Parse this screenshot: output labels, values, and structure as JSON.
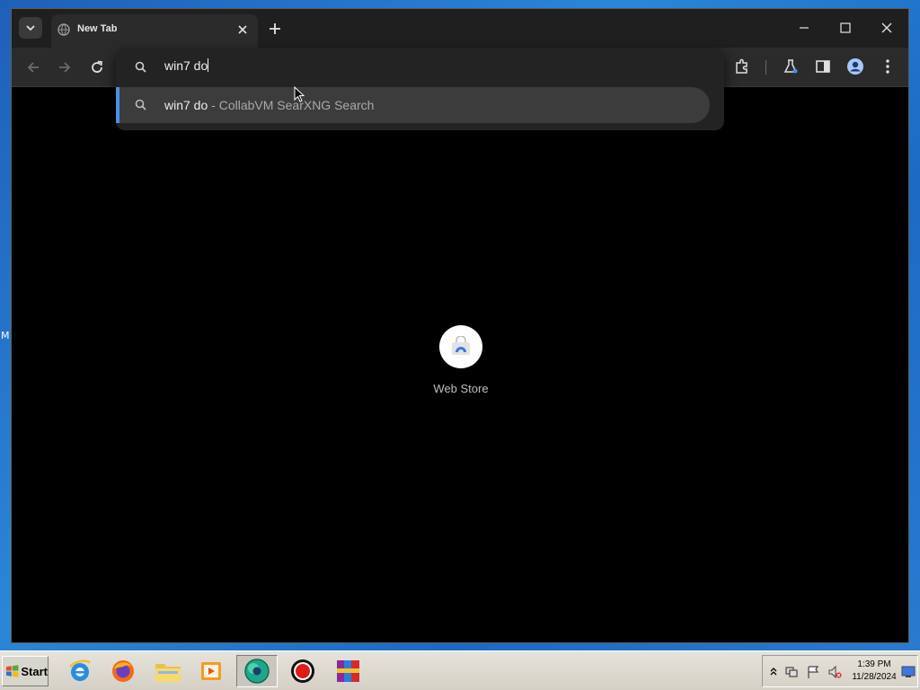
{
  "desktop": {
    "edge_text": "M"
  },
  "browser": {
    "tab": {
      "title": "New Tab"
    },
    "omnibox": {
      "value": "win7 do",
      "suggestion": {
        "query": "win7 do",
        "rest": " - CollabVM SearXNG Search"
      }
    },
    "shortcuts": [
      {
        "label": "Web Store",
        "icon": "webstore-icon"
      }
    ],
    "colors": {
      "accent": "#4a8fe6",
      "page_bg": "#000000",
      "chrome_bg": "#1f1f1f"
    }
  },
  "taskbar": {
    "start_label": "Start",
    "apps": [
      {
        "name": "internet-explorer-icon"
      },
      {
        "name": "firefox-icon"
      },
      {
        "name": "file-explorer-icon"
      },
      {
        "name": "media-player-icon"
      },
      {
        "name": "chrome-icon",
        "active": true
      },
      {
        "name": "record-icon"
      },
      {
        "name": "winrar-icon"
      }
    ],
    "clock": {
      "time": "1:39 PM",
      "date": "11/28/2024"
    }
  }
}
